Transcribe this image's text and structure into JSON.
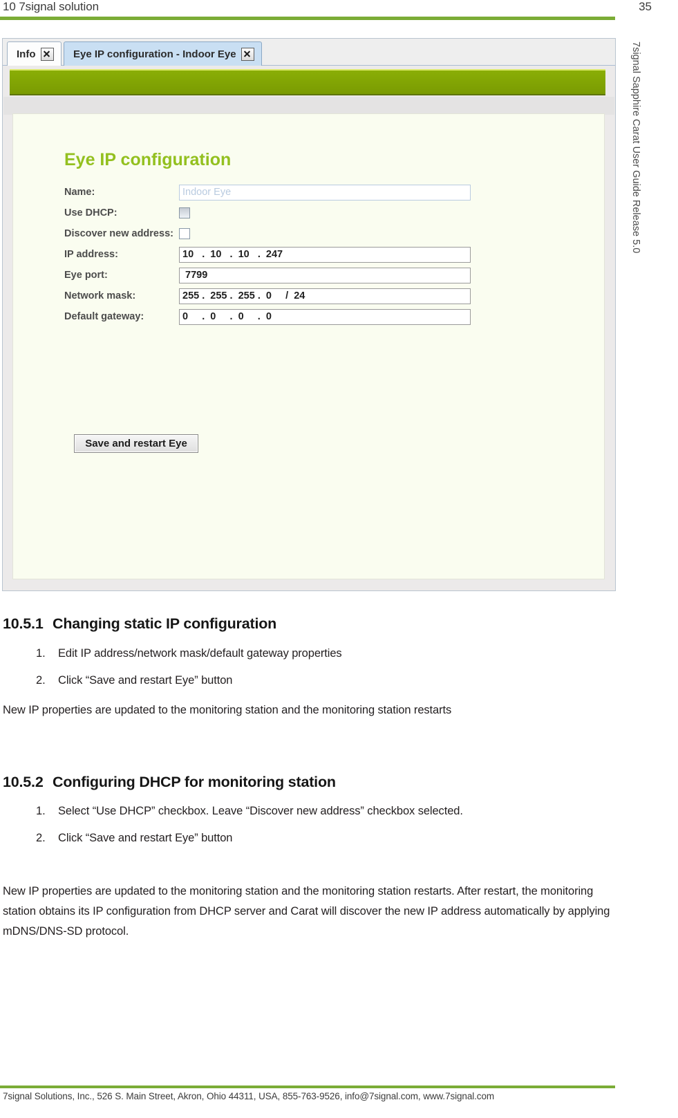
{
  "header": {
    "title": "10 7signal solution",
    "page_number": "35"
  },
  "side_title": "7signal Sapphire Carat User Guide Release 5.0",
  "screenshot": {
    "tabs": [
      {
        "label": "Info",
        "active": false,
        "close_icon": "close-icon"
      },
      {
        "label": "Eye IP configuration - Indoor Eye",
        "active": true,
        "close_icon": "close-icon"
      }
    ],
    "panel_title": "Eye IP configuration",
    "fields": [
      {
        "label": "Name:",
        "type": "text",
        "value": "Indoor Eye",
        "disabled": true
      },
      {
        "label": "Use DHCP:",
        "type": "checkbox",
        "value": "",
        "checked": false,
        "shaded": true
      },
      {
        "label": "Discover new address:",
        "type": "checkbox",
        "value": "",
        "checked": false,
        "shaded": false
      },
      {
        "label": "IP address:",
        "type": "text",
        "value": "10   .  10   .  10   .  247",
        "disabled": false
      },
      {
        "label": "Eye port:",
        "type": "text",
        "value": " 7799",
        "disabled": false
      },
      {
        "label": "Network mask:",
        "type": "text",
        "value": "255 .  255 .  255 .  0     /  24",
        "disabled": false
      },
      {
        "label": "Default gateway:",
        "type": "text",
        "value": "0     .  0     .  0     .  0",
        "disabled": false
      }
    ],
    "save_button": "Save and restart Eye",
    "accent_green": "#8aae06",
    "title_green": "#93c01f",
    "active_tab_blue": "#c9dff3"
  },
  "sections": [
    {
      "number": "10.5.1",
      "title": "Changing static IP configuration",
      "items": [
        {
          "num": "1.",
          "text": "Edit IP address/network mask/default gateway properties"
        },
        {
          "num": "2.",
          "text": "Click “Save and restart Eye” button"
        }
      ],
      "paragraph": "New IP properties are updated to the monitoring station and the monitoring station restarts"
    },
    {
      "number": "10.5.2",
      "title": "Configuring DHCP for monitoring station",
      "items": [
        {
          "num": "1.",
          "text": "Select “Use DHCP” checkbox. Leave “Discover new address” checkbox selected."
        },
        {
          "num": "2.",
          "text": "Click “Save and restart Eye” button"
        }
      ],
      "paragraph": "New IP properties are updated to the monitoring station and the monitoring station restarts. After restart, the monitoring station obtains its IP configuration from DHCP server and Carat will discover the new IP address automatically by applying mDNS/DNS-SD protocol."
    }
  ],
  "footer": {
    "text": "7signal Solutions, Inc., 526 S. Main Street, Akron, Ohio 44311, USA, 855-763-9526, info@7signal.com, www.7signal.com",
    "rule_color": "#7bac36"
  }
}
